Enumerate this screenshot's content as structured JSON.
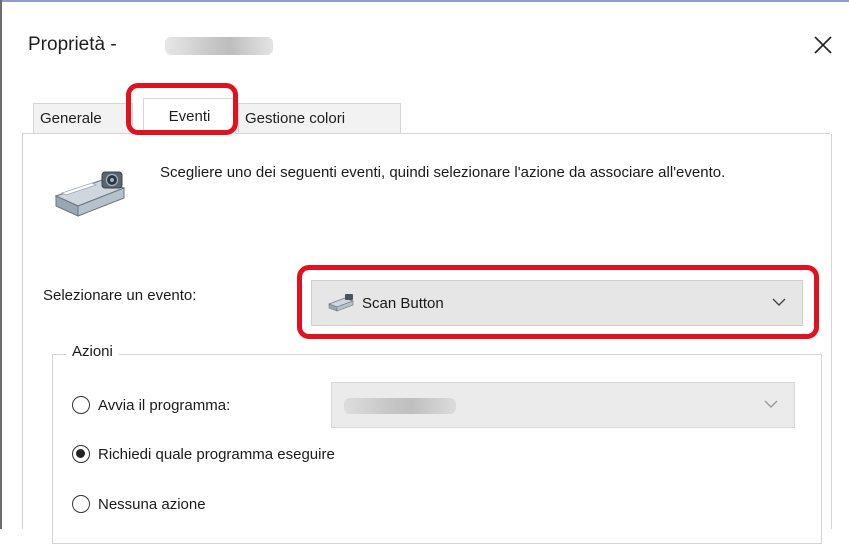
{
  "window": {
    "title": "Proprietà -",
    "close_glyph": "✕"
  },
  "tabs": [
    {
      "label": "Generale",
      "selected": false
    },
    {
      "label": "Eventi",
      "selected": true
    },
    {
      "label": "Gestione colori",
      "selected": false
    }
  ],
  "events_panel": {
    "description": "Scegliere uno dei seguenti eventi, quindi selezionare l'azione da associare all'evento.",
    "event_label": "Selezionare un evento:",
    "event_select": {
      "value": "Scan Button",
      "icon": "scanner-icon"
    }
  },
  "actions": {
    "title": "Azioni",
    "options": [
      {
        "label": "Avvia il programma:",
        "checked": false
      },
      {
        "label": "Richiedi quale programma eseguire",
        "checked": true
      },
      {
        "label": "Nessuna azione",
        "checked": false
      }
    ],
    "program_select": {
      "enabled": false
    }
  },
  "colors": {
    "highlight": "#e0121f",
    "select_bg": "#e6e6e6",
    "disabled_select_bg": "#ebebeb"
  }
}
